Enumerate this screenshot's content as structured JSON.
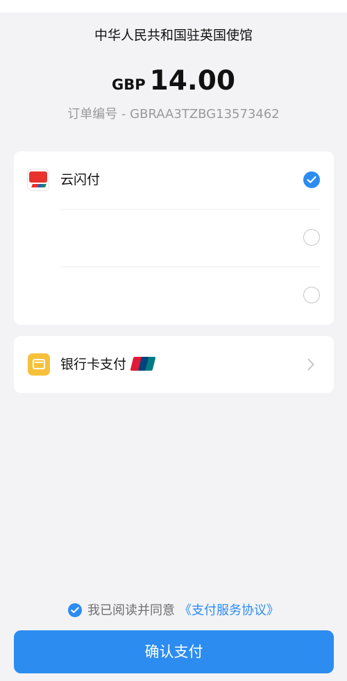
{
  "payment": {
    "merchant": "中华人民共和国驻英国使馆",
    "currency": "GBP",
    "amount": "14.00",
    "order_number": "订单编号 - GBRAA3TZBG13573462"
  },
  "methods": [
    {
      "label": "云闪付",
      "icon": "cloud-quickpass-icon",
      "selected": true
    },
    {
      "label": "",
      "selected": false
    },
    {
      "label": "",
      "selected": false
    }
  ],
  "bank_card": {
    "label": "银行卡支付",
    "icon": "wallet-icon",
    "badge_icon": "unionpay-icon"
  },
  "agreement": {
    "text": "我已阅读并同意",
    "link": "《支付服务协议》",
    "checked": true
  },
  "confirm_label": "确认支付",
  "colors": {
    "accent": "#2c8cf0",
    "background": "#f3f3f5",
    "card": "#ffffff",
    "wallet": "#f6c03a"
  }
}
